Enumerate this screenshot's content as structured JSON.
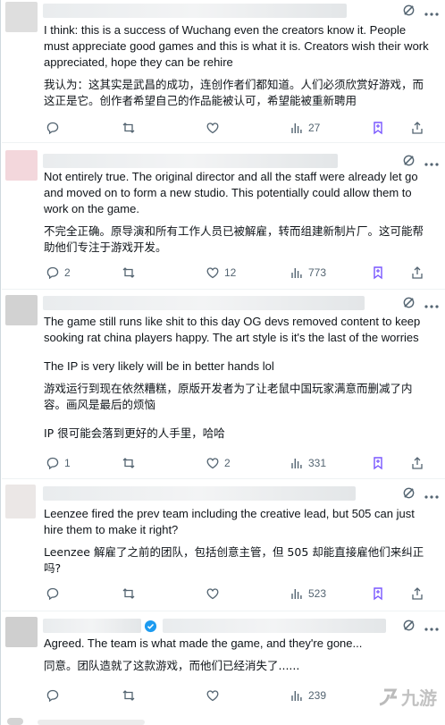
{
  "posts": [
    {
      "text_en": "I think: this is a success of Wuchang  even the creators know it. People must appreciate good games and this is what it is. Creators wish their work appreciated, hope they can be rehire",
      "text_zh": "我认为：这其实是武昌的成功，连创作者们都知道。人们必须欣赏好游戏，而这正是它。创作者希望自己的作品能被认可，希望能被重新聘用",
      "replies": "",
      "reposts": "",
      "likes": "",
      "views": "27"
    },
    {
      "text_en": "Not entirely true. The original director and all the staff were already let go and moved on to form a new studio. This potentially could allow them to work on the game.",
      "text_zh": "不完全正确。原导演和所有工作人员已被解雇，转而组建新制片厂。这可能帮助他们专注于游戏开发。",
      "replies": "2",
      "reposts": "",
      "likes": "12",
      "views": "773"
    },
    {
      "text_en": "The game still runs like shit to this day OG devs removed content to keep sooking rat china players happy. The art style is it's the last of the worries",
      "text_en2": "The IP is very likely will be in better hands lol",
      "text_zh": "游戏运行到现在依然糟糕，原版开发者为了让老鼠中国玩家满意而删减了内容。画风是最后的烦恼",
      "text_zh2": "IP 很可能会落到更好的人手里，哈哈",
      "replies": "1",
      "reposts": "",
      "likes": "2",
      "views": "331"
    },
    {
      "text_en": "Leenzee fired the prev team including the creative lead, but 505 can just hire them to make it right?",
      "text_zh": "Leenzee 解雇了之前的团队，包括创意主管，但 505 却能直接雇他们来纠正吗?",
      "replies": "",
      "reposts": "",
      "likes": "",
      "views": "523"
    },
    {
      "text_en": "Agreed. The team is what made the game, and they're gone...",
      "text_zh": "同意。团队造就了这款游戏，而他们已经消失了......",
      "replies": "",
      "reposts": "",
      "likes": "",
      "views": "239"
    }
  ],
  "icons": {
    "grok": "grok-icon",
    "more": "more-icon",
    "reply": "reply-icon",
    "repost": "repost-icon",
    "like": "like-icon",
    "views": "views-icon",
    "bookmark": "bookmark-icon",
    "share": "share-icon"
  },
  "colors": {
    "text": "#0f1419",
    "muted": "#536471",
    "accent": "#1d9bf0",
    "bookmark_accent": "#7856ff"
  },
  "watermark": "九游"
}
